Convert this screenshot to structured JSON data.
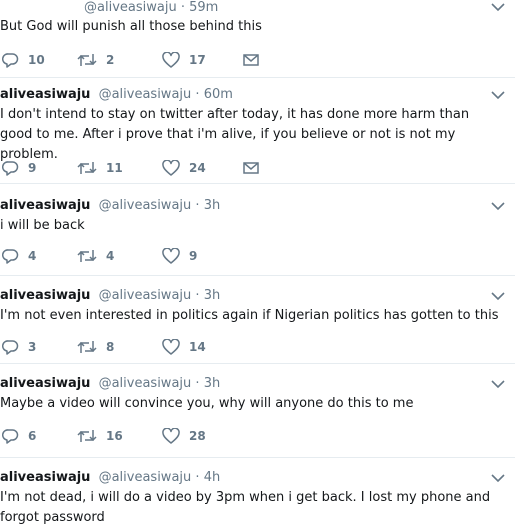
{
  "tweets": [
    {
      "name": "",
      "handle": "@aliveasiwaju",
      "dot": "·",
      "time": "59m",
      "text": "But God will punish all those behind this",
      "replies": "10",
      "retweets": "2",
      "likes": "17"
    },
    {
      "name": "aliveasiwaju",
      "handle": "@aliveasiwaju",
      "dot": "·",
      "time": "60m",
      "text": "I don't intend to stay on twitter after today, it has done more harm than good to me. After i prove that i'm alive, if you believe or not is not my problem.",
      "replies": "9",
      "retweets": "11",
      "likes": "24"
    },
    {
      "name": "aliveasiwaju",
      "handle": "@aliveasiwaju",
      "dot": "·",
      "time": "3h",
      "text": "i will be back",
      "replies": "4",
      "retweets": "4",
      "likes": "9"
    },
    {
      "name": "aliveasiwaju",
      "handle": "@aliveasiwaju",
      "dot": "·",
      "time": "3h",
      "text": "I'm not even interested in politics again if Nigerian politics has gotten to this",
      "replies": "3",
      "retweets": "8",
      "likes": "14"
    },
    {
      "name": "aliveasiwaju",
      "handle": "@aliveasiwaju",
      "dot": "·",
      "time": "3h",
      "text": "Maybe a video will convince you, why will anyone do this to me",
      "replies": "6",
      "retweets": "16",
      "likes": "28"
    },
    {
      "name": "aliveasiwaju",
      "handle": "@aliveasiwaju",
      "dot": "·",
      "time": "4h",
      "text": "I'm not dead, i will do a video by 3pm when i get back. I lost my phone and forgot password",
      "replies": "",
      "retweets": "",
      "likes": ""
    }
  ],
  "colors": {
    "text": "#14171a",
    "muted": "#657786",
    "border": "#e6ecf0"
  },
  "icons": {
    "reply": "reply-icon",
    "retweet": "retweet-icon",
    "like": "heart-icon",
    "dm": "envelope-icon",
    "menu": "chevron-down-icon"
  }
}
